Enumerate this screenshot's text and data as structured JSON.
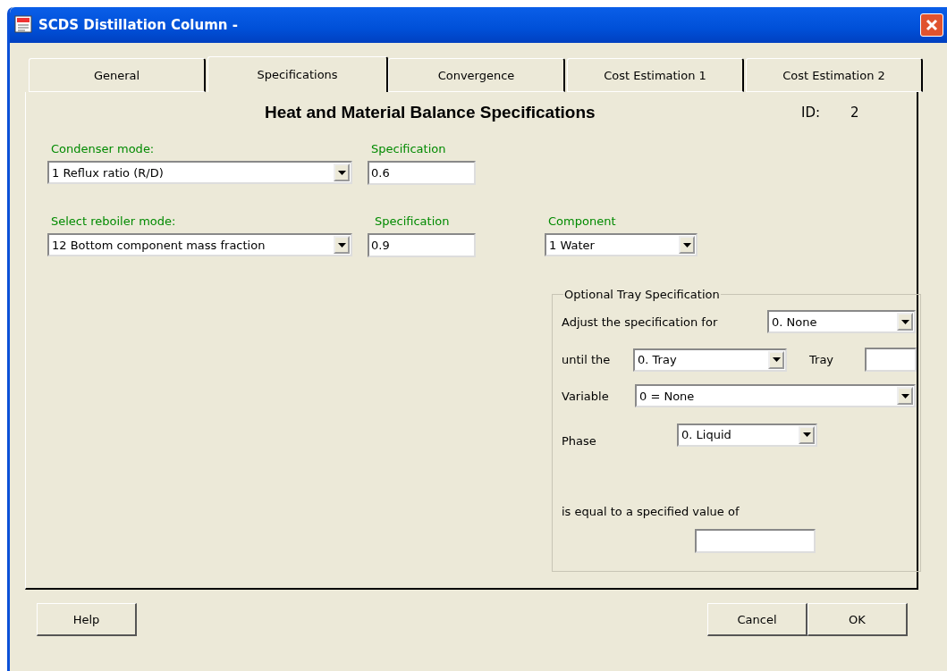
{
  "window": {
    "title": "SCDS Distillation Column -"
  },
  "tabs": [
    {
      "label": "General",
      "selected": false
    },
    {
      "label": "Specifications",
      "selected": true
    },
    {
      "label": "Convergence",
      "selected": false
    },
    {
      "label": "Cost Estimation 1",
      "selected": false
    },
    {
      "label": "Cost Estimation 2",
      "selected": false
    }
  ],
  "heading": "Heat and Material Balance Specifications",
  "id_label": "ID:",
  "id_value": "2",
  "condenser": {
    "label": "Condenser mode:",
    "value": "1 Reflux ratio (R/D)",
    "spec_label": "Specification",
    "spec_value": "0.6"
  },
  "reboiler": {
    "label": "Select reboiler mode:",
    "value": "12 Bottom component mass fraction",
    "spec_label": "Specification",
    "spec_value": "0.9",
    "component_label": "Component",
    "component_value": "1 Water"
  },
  "optional_tray": {
    "title": "Optional Tray Specification",
    "adjust_label": "Adjust the specification for",
    "adjust_value": "0. None",
    "until_label": "until the",
    "until_value": "0. Tray",
    "tray_label": "Tray",
    "variable_label": "Variable",
    "variable_value": "0 = None",
    "phase_label": "Phase",
    "phase_value": "0. Liquid",
    "equal_label": "is equal to a specified value of"
  },
  "buttons": {
    "help": "Help",
    "cancel": "Cancel",
    "ok": "OK"
  }
}
